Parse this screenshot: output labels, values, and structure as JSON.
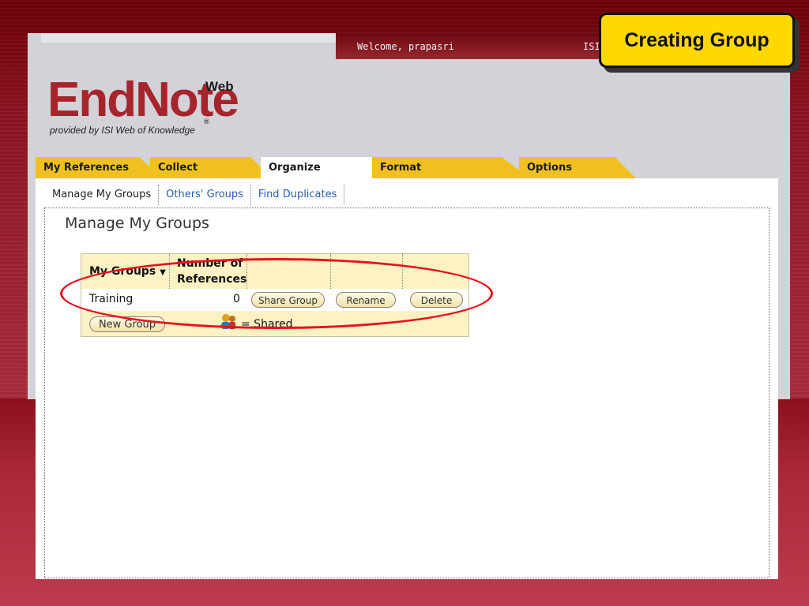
{
  "header": {
    "welcome": "Welcome, prapasri",
    "isi_label": "ISI"
  },
  "logo": {
    "main": "EndNote",
    "sup": "Web",
    "provided_by": "provided by ISI Web of Knowledge",
    "registered": "®"
  },
  "tabs": [
    {
      "label": "My References"
    },
    {
      "label": "Collect"
    },
    {
      "label": "Organize"
    },
    {
      "label": "Format"
    },
    {
      "label": "Options"
    }
  ],
  "active_tab": "Organize",
  "subnav": [
    {
      "label": "Manage My Groups"
    },
    {
      "label": "Others' Groups"
    },
    {
      "label": "Find Duplicates"
    }
  ],
  "page_title": "Manage My Groups",
  "table": {
    "col_groups": "My Groups",
    "sort_indicator": "▼",
    "col_refs_line1": "Number of",
    "col_refs_line2": "References",
    "rows": [
      {
        "name": "Training",
        "count": "0",
        "share": "Share Group",
        "rename": "Rename",
        "delete": "Delete"
      }
    ],
    "new_group": "New Group",
    "shared_legend": "= Shared"
  },
  "callout": {
    "text": "Creating Group"
  },
  "colors": {
    "accent_tab": "#f0c020",
    "callout_bg": "#ffd800",
    "highlight_ellipse": "#e8101c",
    "link": "#2a5db0"
  }
}
